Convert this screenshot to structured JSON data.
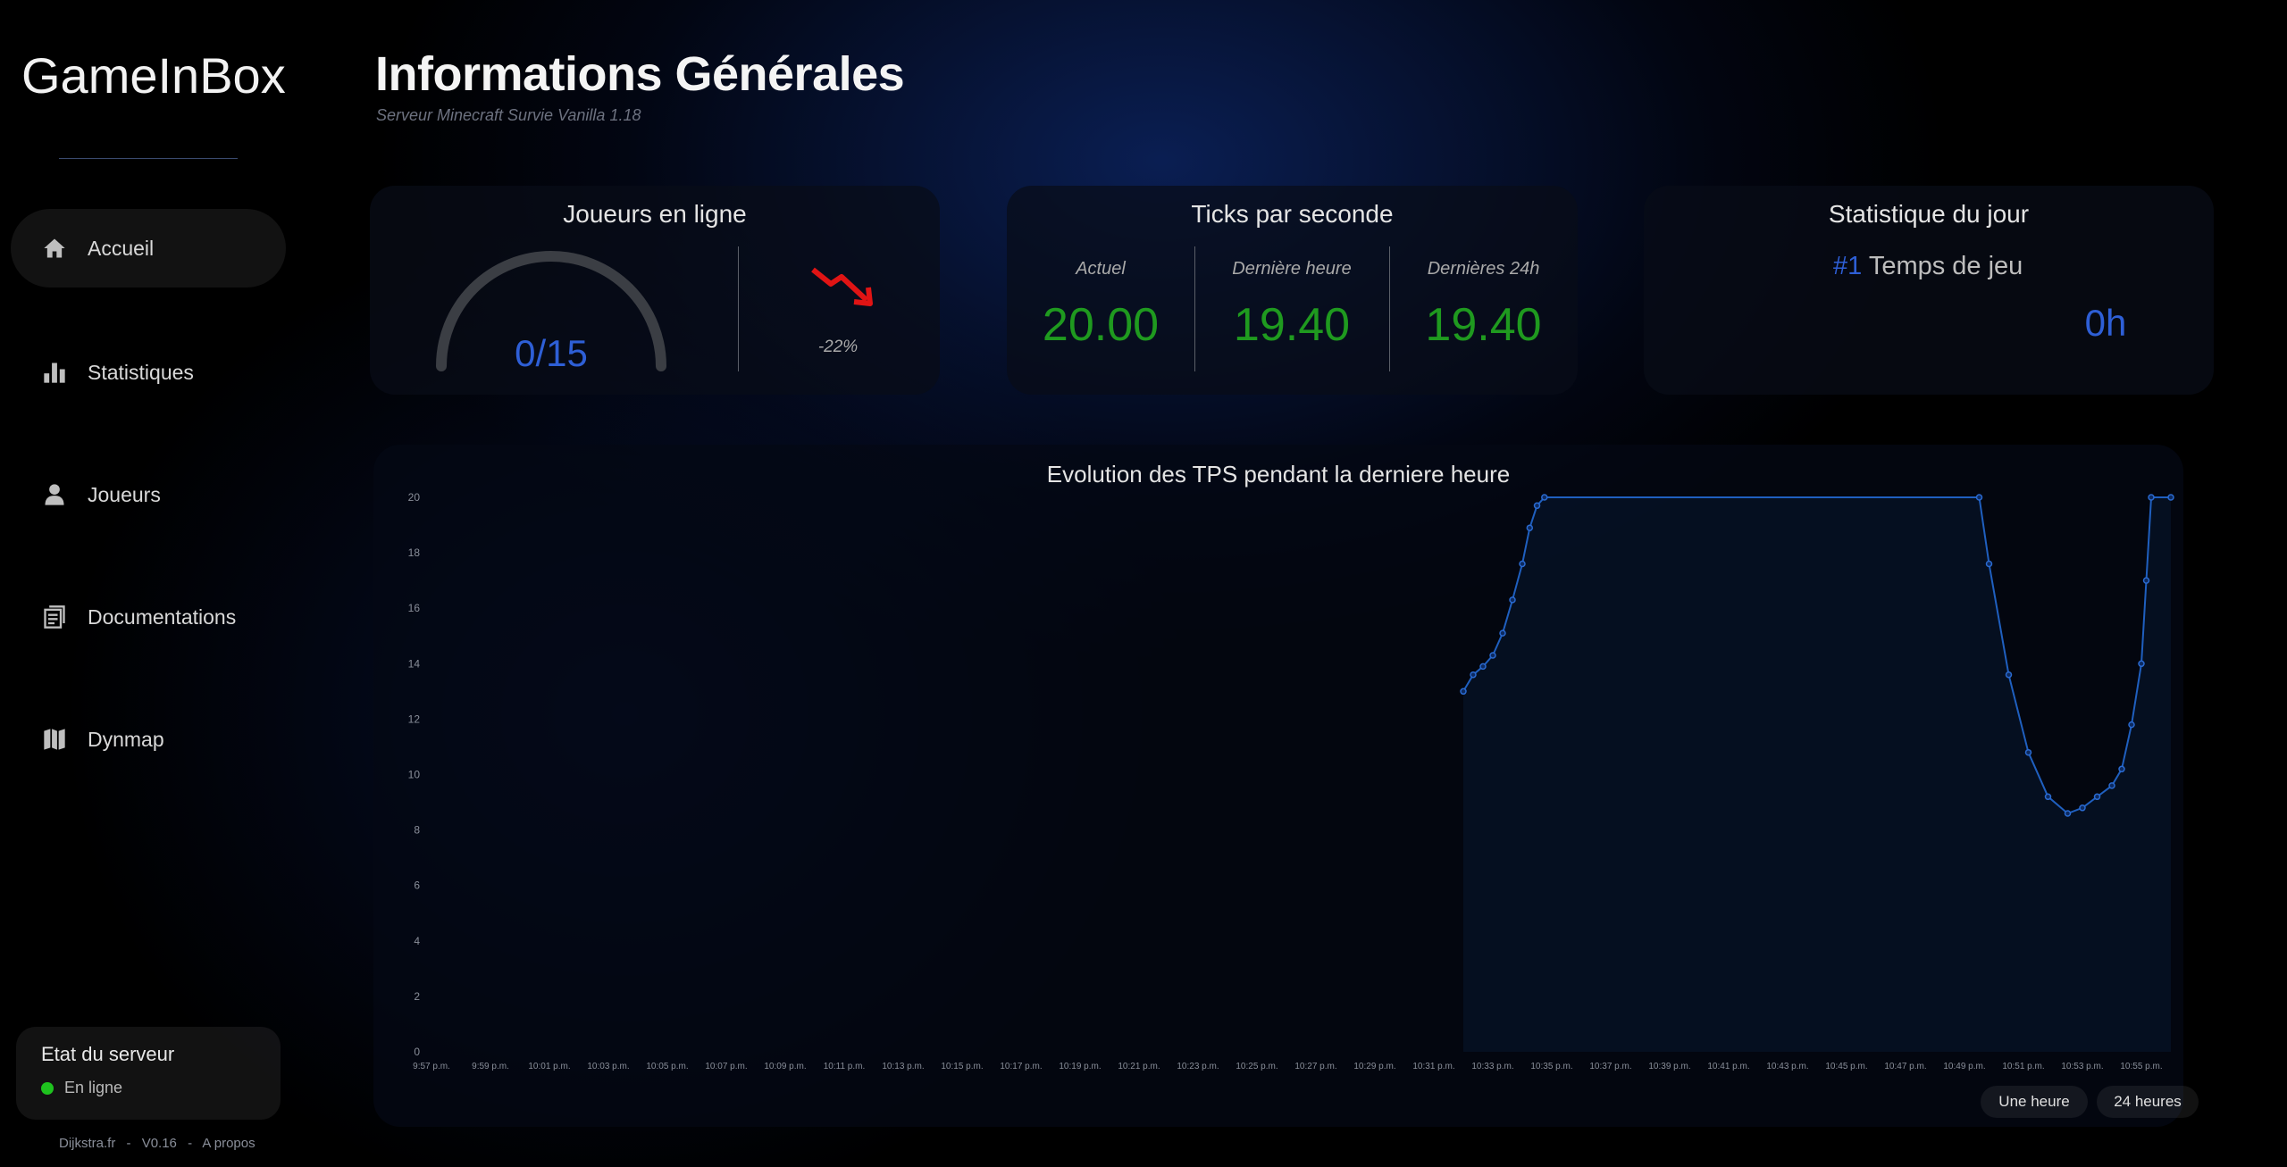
{
  "app": {
    "name": "GameInBox"
  },
  "sidebar": {
    "items": [
      {
        "label": "Accueil",
        "icon": "home-icon",
        "active": true
      },
      {
        "label": "Statistiques",
        "icon": "bar-chart-icon",
        "active": false
      },
      {
        "label": "Joueurs",
        "icon": "user-icon",
        "active": false
      },
      {
        "label": "Documentations",
        "icon": "document-icon",
        "active": false
      },
      {
        "label": "Dynmap",
        "icon": "map-icon",
        "active": false
      }
    ],
    "server": {
      "title": "Etat du serveur",
      "status": "En ligne",
      "status_color": "#1ec21e"
    },
    "footer": {
      "site": "Dijkstra.fr",
      "sep1": "-",
      "version": "V0.16",
      "sep2": "-",
      "about": "A propos"
    }
  },
  "header": {
    "title": "Informations Générales",
    "subtitle": "Serveur Minecraft Survie Vanilla 1.18"
  },
  "cards": {
    "players": {
      "title": "Joueurs en ligne",
      "value": "0/15",
      "fraction": 0,
      "trend": "-22%",
      "trend_icon": "trending-down-icon",
      "trend_color": "#e01414"
    },
    "tps": {
      "title": "Ticks par seconde",
      "columns": [
        {
          "label": "Actuel",
          "value": "20.00"
        },
        {
          "label": "Dernière heure",
          "value": "19.40"
        },
        {
          "label": "Dernières 24h",
          "value": "19.40"
        }
      ]
    },
    "daily": {
      "title": "Statistique du jour",
      "rank": "#1",
      "label": "Temps de jeu",
      "value": "0h"
    }
  },
  "colors": {
    "accent": "#2e5fd6",
    "green": "#1f9a1f",
    "line": "#1f5fbf"
  },
  "chart_data": {
    "type": "line",
    "title": "Evolution des TPS pendant la derniere heure",
    "ylim": [
      0,
      20
    ],
    "yticks": [
      0,
      2,
      4,
      6,
      8,
      10,
      12,
      14,
      16,
      18,
      20
    ],
    "x_tick_labels": [
      "9:57 p.m.",
      "9:59 p.m.",
      "10:01 p.m.",
      "10:03 p.m.",
      "10:05 p.m.",
      "10:07 p.m.",
      "10:09 p.m.",
      "10:11 p.m.",
      "10:13 p.m.",
      "10:15 p.m.",
      "10:17 p.m.",
      "10:19 p.m.",
      "10:21 p.m.",
      "10:23 p.m.",
      "10:25 p.m.",
      "10:27 p.m.",
      "10:29 p.m.",
      "10:31 p.m.",
      "10:33 p.m.",
      "10:35 p.m.",
      "10:37 p.m.",
      "10:39 p.m.",
      "10:41 p.m.",
      "10:43 p.m.",
      "10:45 p.m.",
      "10:47 p.m.",
      "10:49 p.m.",
      "10:51 p.m.",
      "10:53 p.m.",
      "10:55 p.m."
    ],
    "x_start": "9:57 p.m.",
    "x_end": "10:56 p.m.",
    "series": [
      {
        "points": [
          [
            "10:32 p.m.",
            13.0
          ],
          [
            "10:32:20 p.m.",
            13.6
          ],
          [
            "10:32:40 p.m.",
            13.9
          ],
          [
            "10:33 p.m.",
            14.3
          ],
          [
            "10:33:20 p.m.",
            15.1
          ],
          [
            "10:33:40 p.m.",
            16.3
          ],
          [
            "10:34 p.m.",
            17.6
          ],
          [
            "10:34:15 p.m.",
            18.9
          ],
          [
            "10:34:30 p.m.",
            19.7
          ],
          [
            "10:34:45 p.m.",
            20.0
          ],
          [
            "10:49:30 p.m.",
            20.0
          ],
          [
            "10:49:50 p.m.",
            17.6
          ],
          [
            "10:50:30 p.m.",
            13.6
          ],
          [
            "10:51:10 p.m.",
            10.8
          ],
          [
            "10:51:50 p.m.",
            9.2
          ],
          [
            "10:52:30 p.m.",
            8.6
          ],
          [
            "10:53 p.m.",
            8.8
          ],
          [
            "10:53:30 p.m.",
            9.2
          ],
          [
            "10:54 p.m.",
            9.6
          ],
          [
            "10:54:20 p.m.",
            10.2
          ],
          [
            "10:54:40 p.m.",
            11.8
          ],
          [
            "10:55 p.m.",
            14.0
          ],
          [
            "10:55:10 p.m.",
            17.0
          ],
          [
            "10:55:20 p.m.",
            20.0
          ],
          [
            "10:56 p.m.",
            20.0
          ]
        ]
      }
    ],
    "grid": false,
    "legend": "none"
  },
  "chart_controls": {
    "hour_label": "Une heure",
    "day_label": "24 heures"
  }
}
